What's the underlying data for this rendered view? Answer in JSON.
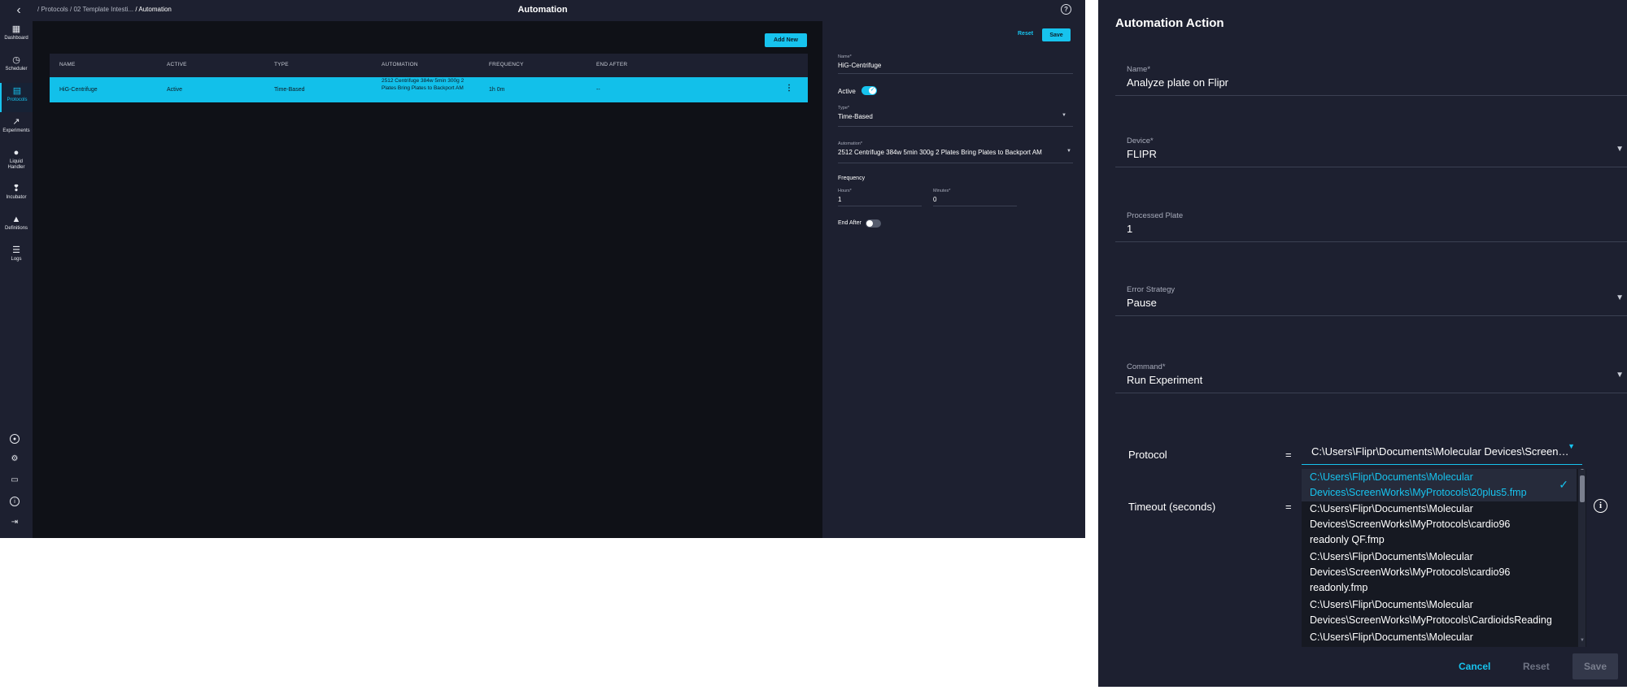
{
  "topbar": {
    "breadcrumb_root": "/ Protocols",
    "breadcrumb_mid": "/ 02 Template Intesti...",
    "breadcrumb_current": "/ Automation",
    "title": "Automation"
  },
  "sidebar": {
    "items": [
      {
        "label": "Dashboard",
        "icon": "dashboard-icon"
      },
      {
        "label": "Scheduler",
        "icon": "clock-icon"
      },
      {
        "label": "Protocols",
        "icon": "file-icon"
      },
      {
        "label": "Experiments",
        "icon": "trend-icon"
      },
      {
        "label": "Liquid Handler",
        "icon": "drop-icon"
      },
      {
        "label": "Incubator",
        "icon": "thermometer-icon"
      },
      {
        "label": "Definitions",
        "icon": "flask-icon"
      },
      {
        "label": "Logs",
        "icon": "list-icon"
      }
    ],
    "active": "Protocols"
  },
  "table": {
    "add_new_label": "Add New",
    "columns": [
      "NAME",
      "ACTIVE",
      "TYPE",
      "AUTOMATION",
      "FREQUENCY",
      "END AFTER"
    ],
    "rows": [
      {
        "name": "HiG-Centrifuge",
        "active": "Active",
        "type": "Time-Based",
        "automation": "2512 Centrifuge 384w 5min 300g 2 Plates Bring Plates to Backport AM",
        "frequency": "1h 0m",
        "end_after": "--"
      }
    ]
  },
  "detail": {
    "reset_label": "Reset",
    "save_label": "Save",
    "name_label": "Name*",
    "name_value": "HiG-Centrifuge",
    "active_label": "Active",
    "active_on": true,
    "type_label": "Type*",
    "type_value": "Time-Based",
    "automation_label": "Automation*",
    "automation_value": "2512 Centrifuge 384w 5min 300g 2 Plates Bring Plates to Backport AM",
    "frequency_label": "Frequency",
    "hours_label": "Hours*",
    "hours_value": "1",
    "minutes_label": "Minutes*",
    "minutes_value": "0",
    "end_after_label": "End After",
    "end_after_on": false
  },
  "dialog": {
    "title": "Automation Action",
    "fields": {
      "name_label": "Name*",
      "name_value": "Analyze plate on Flipr",
      "device_label": "Device*",
      "device_value": "FLIPR",
      "processed_plate_label": "Processed Plate",
      "processed_plate_value": "1",
      "error_strategy_label": "Error Strategy",
      "error_strategy_value": "Pause",
      "command_label": "Command*",
      "command_value": "Run Experiment"
    },
    "protocol_label": "Protocol",
    "protocol_eq": "=",
    "protocol_value": "C:\\Users\\Flipr\\Documents\\Molecular Devices\\ScreenWorks\\MyProtocols\\20plus5.fmp",
    "timeout_label": "Timeout (seconds)",
    "timeout_eq": "=",
    "options": [
      {
        "line1": "C:\\Users\\Flipr\\Documents\\Molecular",
        "line2": "Devices\\ScreenWorks\\MyProtocols\\20plus5.fmp",
        "line3": ""
      },
      {
        "line1": "C:\\Users\\Flipr\\Documents\\Molecular",
        "line2": "Devices\\ScreenWorks\\MyProtocols\\cardio96",
        "line3": "readonly QF.fmp"
      },
      {
        "line1": "C:\\Users\\Flipr\\Documents\\Molecular",
        "line2": "Devices\\ScreenWorks\\MyProtocols\\cardio96",
        "line3": "readonly.fmp"
      },
      {
        "line1": "C:\\Users\\Flipr\\Documents\\Molecular",
        "line2": "Devices\\ScreenWorks\\MyProtocols\\CardioidsReading",
        "line3": ""
      },
      {
        "line1": "C:\\Users\\Flipr\\Documents\\Molecular",
        "line2": "",
        "line3": ""
      }
    ],
    "selected_index": 0,
    "cancel_label": "Cancel",
    "reset_label": "Reset",
    "save_label": "Save"
  },
  "colors": {
    "accent": "#17c3ee",
    "panel": "#1d2030",
    "background": "#0f1117"
  }
}
